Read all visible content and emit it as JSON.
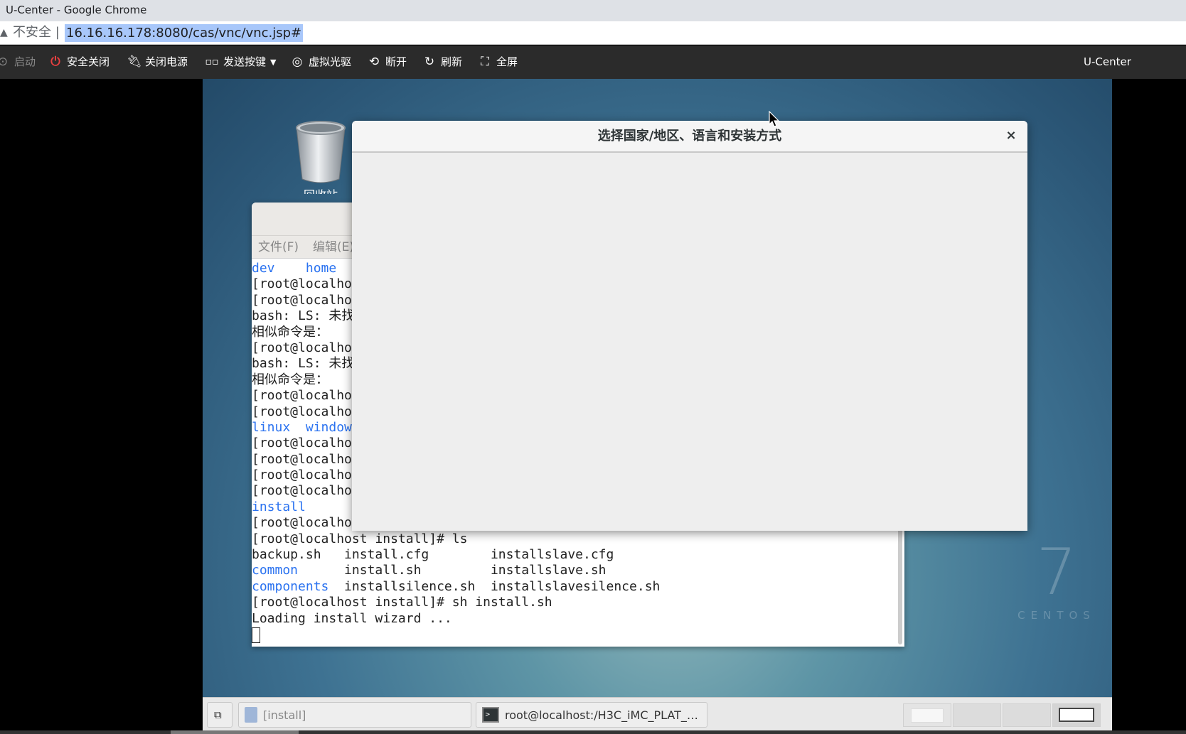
{
  "browser": {
    "window_title": "U-Center - Google Chrome",
    "security_label": "不安全",
    "url": "16.16.16.178:8080/cas/vnc/vnc.jsp#"
  },
  "toolbar": {
    "items": [
      {
        "label": "启动",
        "icon": "play-circle-icon"
      },
      {
        "label": "安全关闭",
        "icon": "power-icon"
      },
      {
        "label": "关闭电源",
        "icon": "plug-icon"
      },
      {
        "label": "发送按键",
        "icon": "keys-icon"
      },
      {
        "label": "虚拟光驱",
        "icon": "disc-icon"
      },
      {
        "label": "断开",
        "icon": "disconnect-icon"
      },
      {
        "label": "刷新",
        "icon": "refresh-icon"
      },
      {
        "label": "全屏",
        "icon": "fullscreen-icon"
      }
    ],
    "brand": "U-Center",
    "colors": {
      "power": "#e84040",
      "background": "#2b2b2b"
    }
  },
  "desktop": {
    "trash_label": "回收站",
    "watermark_number": "7",
    "watermark_word": "CENTOS"
  },
  "terminal": {
    "menu": [
      "文件(F)",
      "编辑(E)"
    ],
    "lines": [
      {
        "text": "dev    home",
        "blue": true
      },
      {
        "text": "[root@localho",
        "blue": false
      },
      {
        "text": "[root@localho",
        "blue": false
      },
      {
        "text": "bash: LS: 未找",
        "blue": false
      },
      {
        "text": "相似命令是：",
        "blue": false
      },
      {
        "text": "[root@localho",
        "blue": false
      },
      {
        "text": "bash: LS: 未找",
        "blue": false
      },
      {
        "text": "相似命令是：",
        "blue": false
      },
      {
        "text": "[root@localho",
        "blue": false
      },
      {
        "text": "[root@localho",
        "blue": false
      },
      {
        "text": "linux  windows",
        "blue": true
      },
      {
        "text": "[root@localho",
        "blue": false
      },
      {
        "text": "[root@localho",
        "blue": false
      },
      {
        "text": "[root@localho",
        "blue": false
      },
      {
        "text": "[root@localho",
        "blue": false
      },
      {
        "text": "install",
        "blue": true
      },
      {
        "text": "[root@localho",
        "blue": false
      },
      {
        "text": "[root@localhost install]# ls",
        "blue": false
      },
      {
        "text": "backup.sh   install.cfg        installslave.cfg",
        "blue": false
      },
      {
        "text": "common      install.sh         installslave.sh",
        "blue": false,
        "blue_prefix": "common"
      },
      {
        "text": "components  installsilence.sh  installslavesilence.sh",
        "blue": false,
        "blue_prefix": "components"
      },
      {
        "text": "[root@localhost install]# sh install.sh",
        "blue": false
      },
      {
        "text": "Loading install wizard ...",
        "blue": false
      }
    ]
  },
  "dialog": {
    "title": "选择国家/地区、语言和安装方式",
    "close": "×"
  },
  "taskbar": {
    "tasks": [
      {
        "label": "[install]",
        "icon": "file-manager-icon"
      },
      {
        "label": "root@localhost:/H3C_iMC_PLAT_…",
        "icon": "terminal-icon"
      }
    ],
    "workspaces": 4,
    "active_workspace": 4
  }
}
